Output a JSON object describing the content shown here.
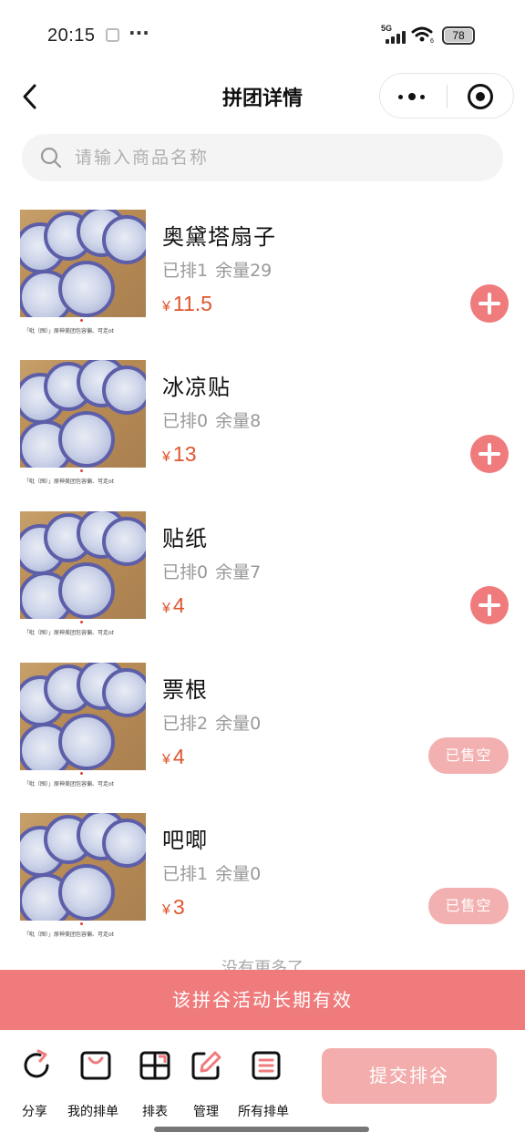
{
  "status_bar": {
    "time": "20:15",
    "network": "5G",
    "wifi_sub": "6",
    "battery": "78"
  },
  "nav": {
    "title": "拼团详情"
  },
  "search": {
    "placeholder": "请输入商品名称"
  },
  "thumb_caption": "「吡（囤）」原神美团包容偏、可走ot",
  "products": [
    {
      "name": "奥黛塔扇子",
      "ordered_label": "已排1",
      "remaining_label": "余量29",
      "currency": "¥",
      "price": "11.5",
      "action": "add"
    },
    {
      "name": "冰凉贴",
      "ordered_label": "已排0",
      "remaining_label": "余量8",
      "currency": "¥",
      "price": "13",
      "action": "add"
    },
    {
      "name": "贴纸",
      "ordered_label": "已排0",
      "remaining_label": "余量7",
      "currency": "¥",
      "price": "4",
      "action": "add"
    },
    {
      "name": "票根",
      "ordered_label": "已排2",
      "remaining_label": "余量0",
      "currency": "¥",
      "price": "4",
      "action": "sold_out",
      "sold_out_label": "已售空"
    },
    {
      "name": "吧唧",
      "ordered_label": "已排1",
      "remaining_label": "余量0",
      "currency": "¥",
      "price": "3",
      "action": "sold_out",
      "sold_out_label": "已售空"
    }
  ],
  "list_end": "没有更多了",
  "banner": {
    "text": "该拼谷活动长期有效"
  },
  "toolbar": {
    "share": "分享",
    "my_orders": "我的排单",
    "sheet": "排表",
    "manage": "管理",
    "all_orders": "所有排单",
    "submit": "提交排谷"
  },
  "colors": {
    "accent": "#ef7b7c",
    "accent_light": "#f3adad",
    "price": "#e0552e",
    "muted_text": "#999999"
  }
}
